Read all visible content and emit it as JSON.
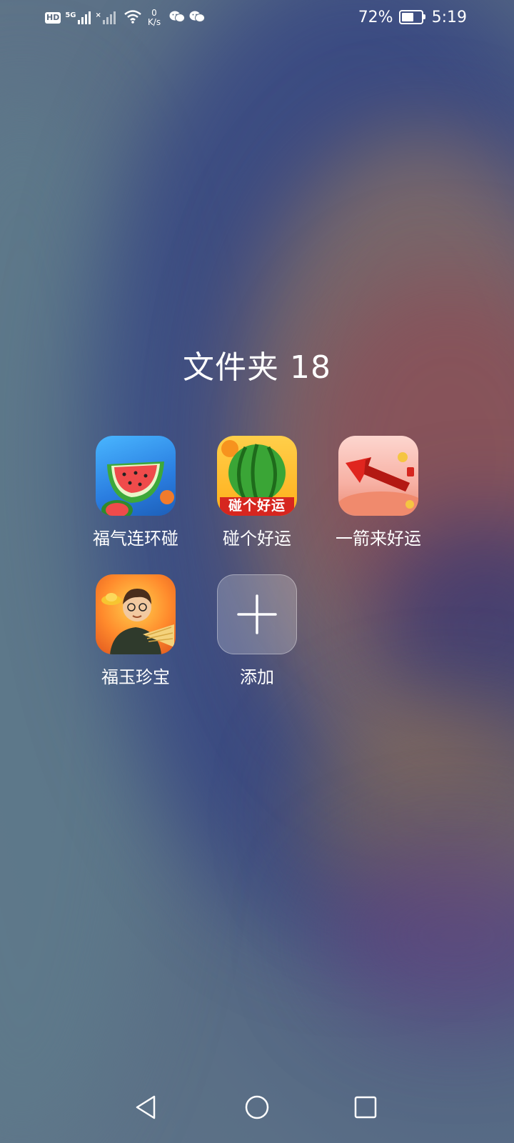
{
  "status_bar": {
    "left_icons": [
      "hd-icon",
      "5g-signal-icon",
      "no-signal-icon",
      "wifi-icon",
      "wechat-icon",
      "wechat-icon"
    ],
    "hd_label": "HD",
    "network_label": "5G",
    "speed_value": "0",
    "speed_unit": "K/s",
    "battery_percent": "72%",
    "battery_level": 0.72,
    "time": "5:19"
  },
  "folder": {
    "title": "文件夹 18",
    "apps": [
      {
        "label": "福气连环碰",
        "icon": "watermelon-slice-icon"
      },
      {
        "label": "碰个好运",
        "icon": "watermelon-icon",
        "icon_text": "碰个好运"
      },
      {
        "label": "一箭来好运",
        "icon": "red-arrow-icon"
      },
      {
        "label": "福玉珍宝",
        "icon": "man-with-gold-icon"
      }
    ],
    "add_label": "添加"
  },
  "nav_bar": {
    "buttons": [
      "back-icon",
      "home-icon",
      "recents-icon"
    ]
  }
}
